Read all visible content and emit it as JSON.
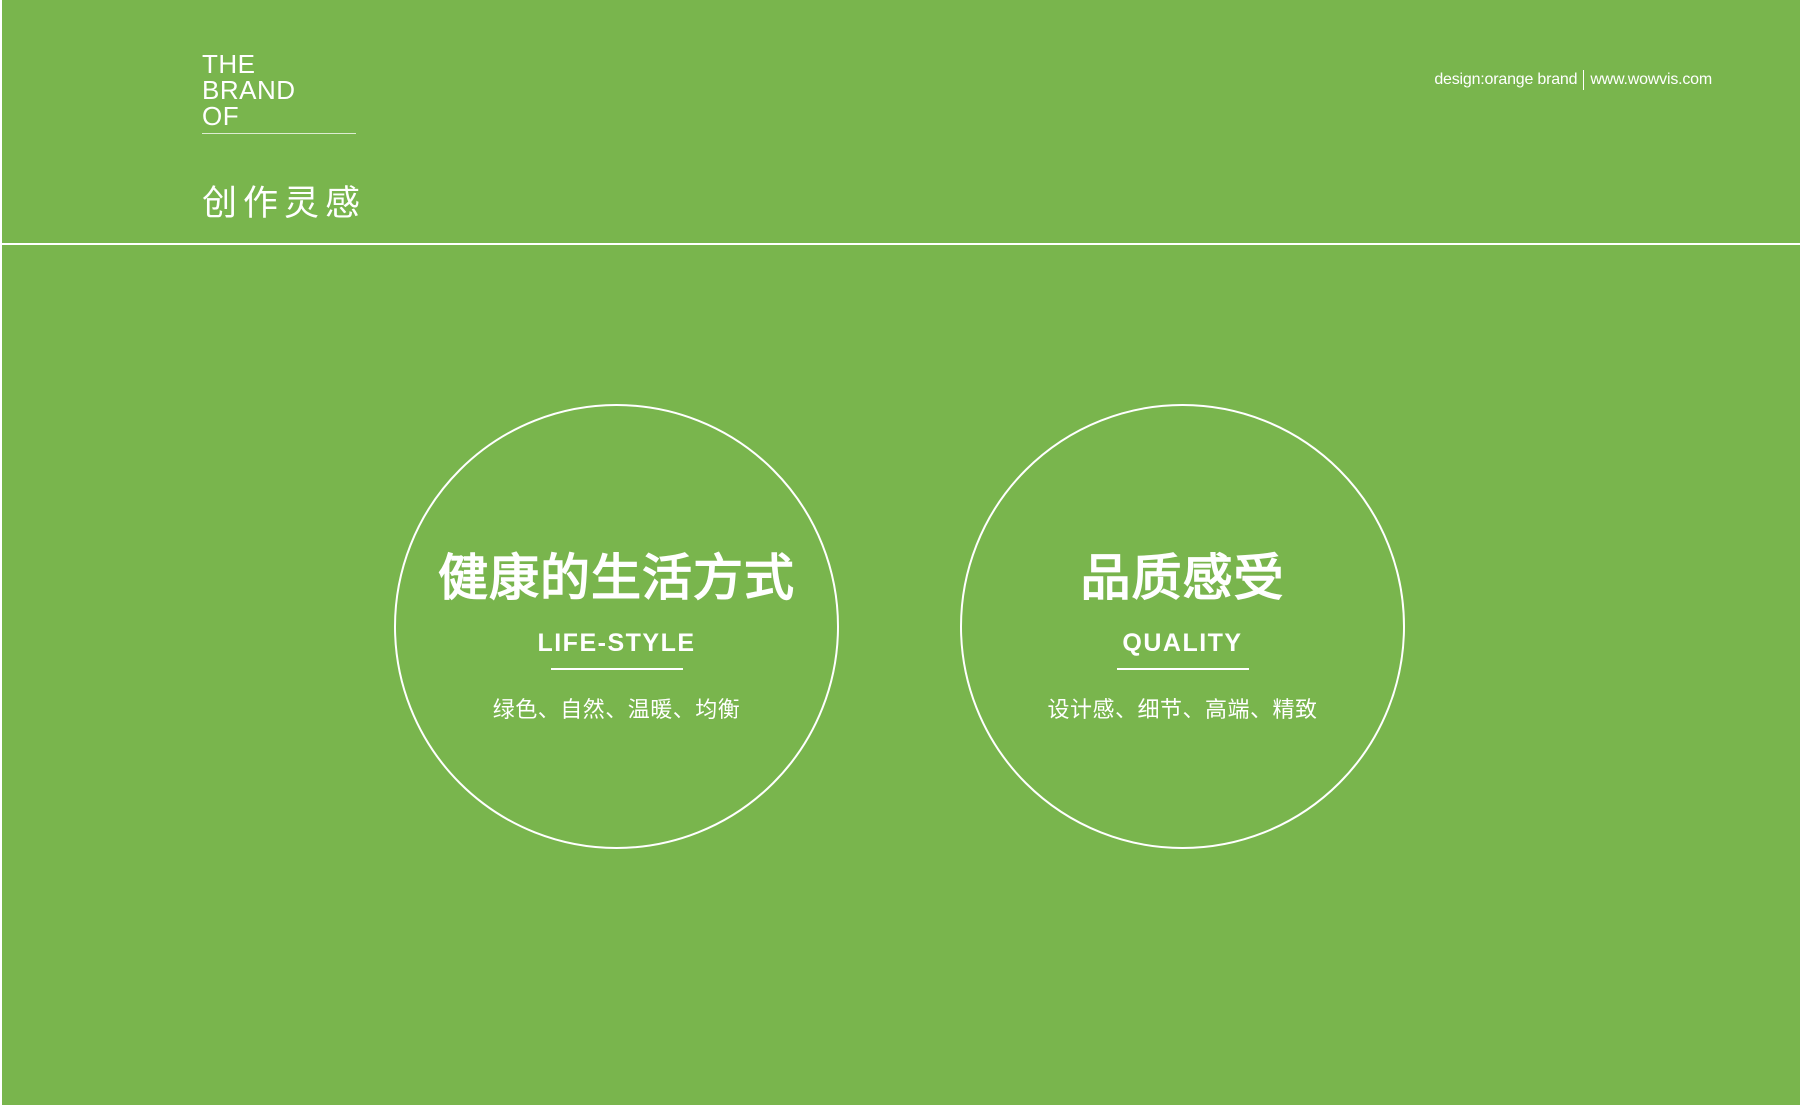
{
  "page": {
    "background_color": "#79b54d",
    "text_color": "#ffffff"
  },
  "brand": {
    "line1": "THE",
    "line2": "BRAND",
    "line3": "OF"
  },
  "credit": {
    "design": "design:orange brand",
    "site": "www.wowvis.com"
  },
  "section": {
    "title": "创作灵感"
  },
  "concepts": [
    {
      "title": "健康的生活方式",
      "english": "LIFE-STYLE",
      "subtitle": "绿色、自然、温暖、均衡"
    },
    {
      "title": "品质感受",
      "english": "QUALITY",
      "subtitle": "设计感、细节、高端、精致"
    }
  ]
}
